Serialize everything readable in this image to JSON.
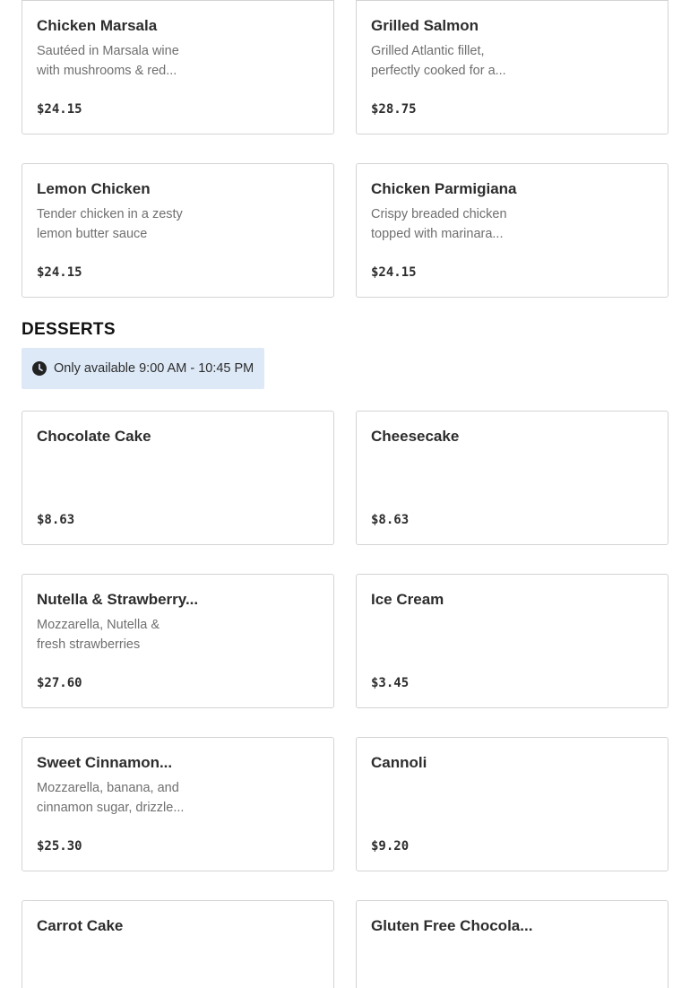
{
  "entrees_continued": [
    {
      "name": "Chicken Marsala",
      "description": "Sautéed in Marsala wine with mushrooms & red...",
      "price": "$24.15"
    },
    {
      "name": "Grilled Salmon",
      "description": "Grilled Atlantic fillet, perfectly cooked for a...",
      "price": "$28.75"
    },
    {
      "name": "Lemon Chicken",
      "description": "Tender chicken in a zesty lemon butter sauce",
      "price": "$24.15"
    },
    {
      "name": "Chicken Parmigiana",
      "description": "Crispy breaded chicken topped with marinara...",
      "price": "$24.15"
    }
  ],
  "desserts": {
    "title": "DESSERTS",
    "availability": {
      "icon": "clock-icon",
      "text": "Only available 9:00 AM - 10:45 PM",
      "background": "#dde9f7"
    },
    "items": [
      {
        "name": "Chocolate Cake",
        "description": "",
        "price": "$8.63"
      },
      {
        "name": "Cheesecake",
        "description": "",
        "price": "$8.63"
      },
      {
        "name": "Nutella & Strawberry...",
        "description": "Mozzarella, Nutella & fresh strawberries",
        "price": "$27.60"
      },
      {
        "name": "Ice Cream",
        "description": "",
        "price": "$3.45"
      },
      {
        "name": "Sweet Cinnamon...",
        "description": "Mozzarella, banana, and cinnamon sugar, drizzle...",
        "price": "$25.30"
      },
      {
        "name": "Cannoli",
        "description": "",
        "price": "$9.20"
      },
      {
        "name": "Carrot Cake",
        "description": "",
        "price": ""
      },
      {
        "name": "Gluten Free Chocola...",
        "description": "",
        "price": ""
      }
    ]
  }
}
